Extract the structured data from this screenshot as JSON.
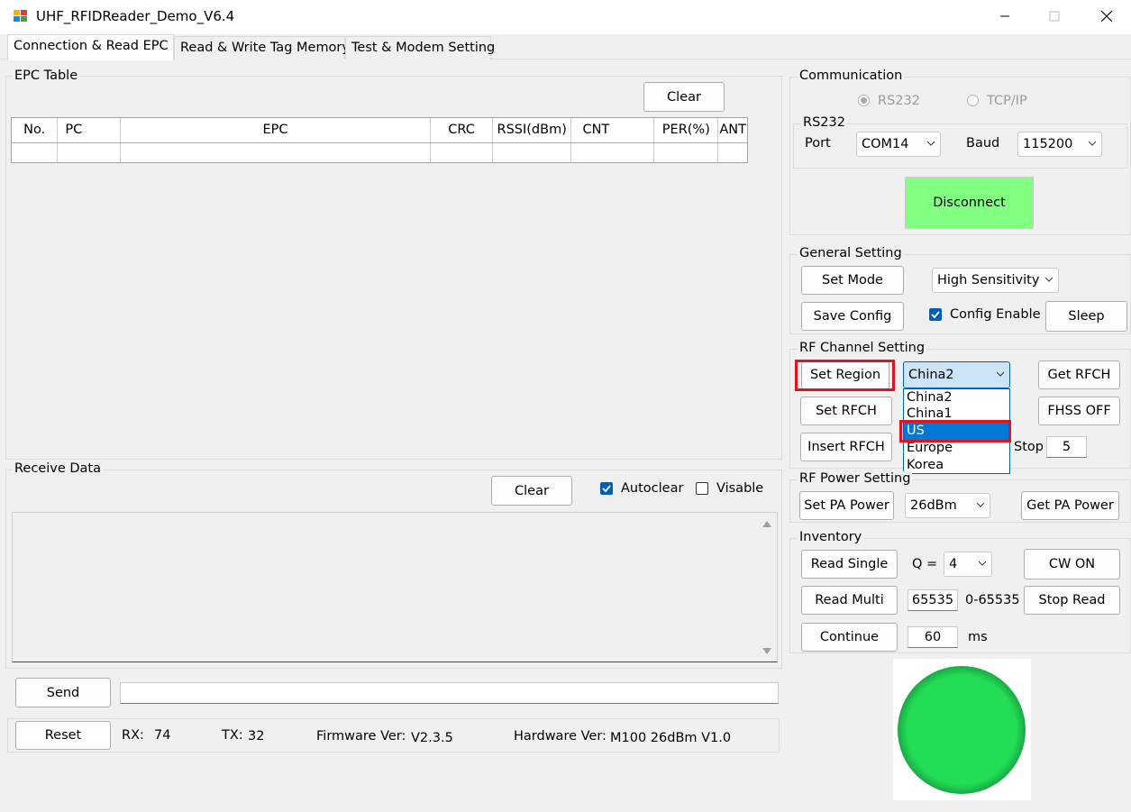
{
  "window": {
    "title": "UHF_RFIDReader_Demo_V6.4"
  },
  "tabs": [
    "Connection & Read EPC",
    "Read & Write Tag Memory",
    "Test & Modem Setting"
  ],
  "epc_table": {
    "group_label": "EPC Table",
    "clear_label": "Clear",
    "columns": [
      "No.",
      "PC",
      "EPC",
      "CRC",
      "RSSI(dBm)",
      "CNT",
      "PER(%)",
      "ANT"
    ]
  },
  "receive": {
    "group_label": "Receive Data",
    "clear_label": "Clear",
    "autoclear_label": "Autoclear",
    "autoclear_checked": true,
    "visable_label": "Visable",
    "visable_checked": false
  },
  "send": {
    "button_label": "Send",
    "value": ""
  },
  "status": {
    "reset_label": "Reset",
    "rx_label": "RX:",
    "rx_value": "74",
    "tx_label": "TX:",
    "tx_value": "32",
    "firmware_label": "Firmware Ver:",
    "firmware_value": "V2.3.5",
    "hardware_label": "Hardware Ver:",
    "hardware_value": "M100 26dBm V1.0"
  },
  "communication": {
    "group_label": "Communication",
    "rs232_radio": "RS232",
    "tcpip_radio": "TCP/IP",
    "sub_label": "RS232",
    "port_label": "Port",
    "port_value": "COM14",
    "baud_label": "Baud",
    "baud_value": "115200",
    "disconnect_label": "Disconnect",
    "disconnect_color": "#80ff80"
  },
  "general": {
    "group_label": "General Setting",
    "set_mode_label": "Set Mode",
    "mode_value": "High Sensitivity",
    "save_config_label": "Save Config",
    "config_enable_label": "Config Enable",
    "config_enable_checked": true,
    "sleep_label": "Sleep"
  },
  "rf_channel": {
    "group_label": "RF Channel Setting",
    "set_region_label": "Set Region",
    "region_value": "China2",
    "region_options": [
      "China2",
      "China1",
      "US",
      "Europe",
      "Korea"
    ],
    "highlighted_option": "US",
    "get_rfch_label": "Get RFCH",
    "set_rfch_label": "Set RFCH",
    "fhss_label": "FHSS OFF",
    "insert_rfch_label": "Insert RFCH",
    "stop_label": "Stop",
    "stop_value": "5",
    "highlight_color": "#e0141e"
  },
  "rf_power": {
    "group_label": "RF Power Setting",
    "set_pa_label": "Set PA Power",
    "power_value": "26dBm",
    "get_pa_label": "Get PA Power"
  },
  "inventory": {
    "group_label": "Inventory",
    "read_single_label": "Read Single",
    "q_label": "Q =",
    "q_value": "4",
    "cw_on_label": "CW ON",
    "read_multi_label": "Read Multi",
    "multi_value": "65535",
    "range_label": "0-65535",
    "stop_read_label": "Stop Read",
    "continue_label": "Continue",
    "interval_value": "60",
    "ms_label": "ms"
  },
  "status_indicator": {
    "color": "#22dd55"
  }
}
